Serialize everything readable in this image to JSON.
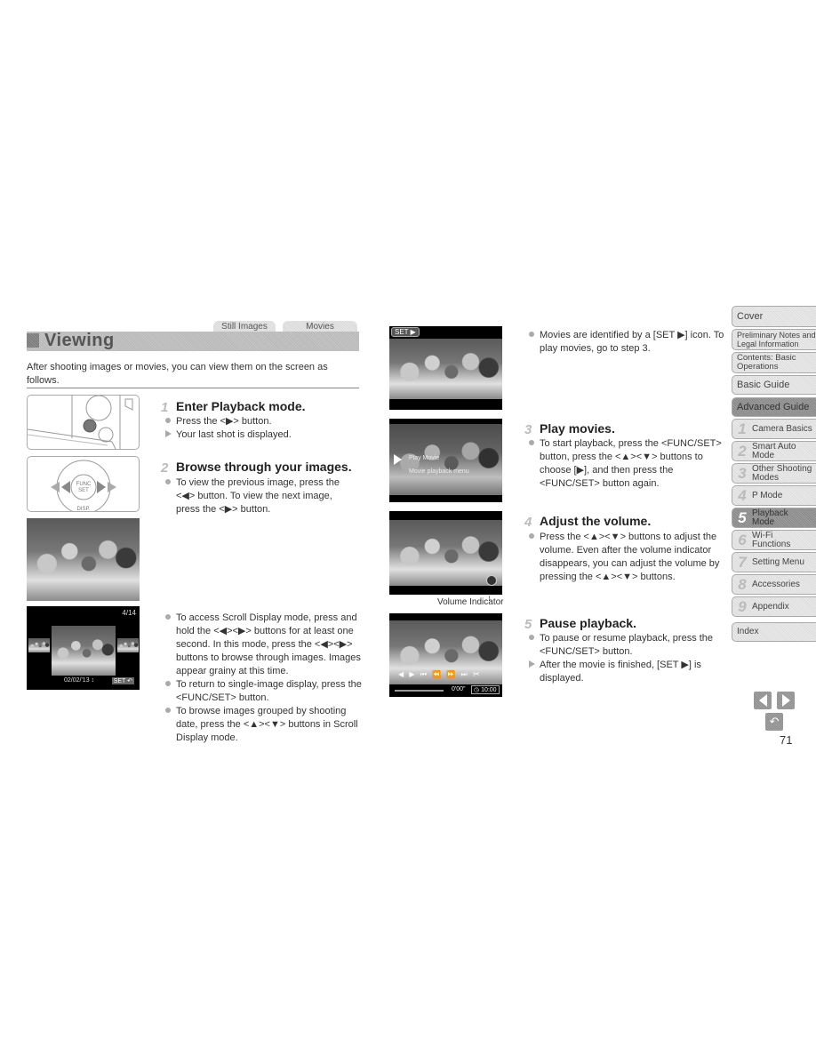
{
  "header": {
    "tabs": [
      "Still Images",
      "Movies"
    ],
    "title": "Viewing",
    "intro": "After shooting images or movies, you can view them on the screen as follows."
  },
  "steps": [
    {
      "number": "1",
      "title": "Enter Playback mode.",
      "items": [
        {
          "type": "bullet",
          "text": "Press the <▶> button."
        },
        {
          "type": "result",
          "text": "Your last shot is displayed."
        }
      ]
    },
    {
      "number": "2",
      "title": "Browse through your images.",
      "items": [
        {
          "type": "bullet",
          "text": "To view the previous image, press the <◀> button. To view the next image, press the <▶> button."
        }
      ],
      "extra_items": [
        {
          "type": "bullet",
          "text": "To access Scroll Display mode, press and hold the <◀><▶> buttons for at least one second. In this mode, press the <◀><▶> buttons to browse through images. Images appear grainy at this time."
        },
        {
          "type": "bullet",
          "text": "To return to single-image display, press the <FUNC/SET> button."
        },
        {
          "type": "bullet",
          "text": "To browse images grouped by shooting date, press the <▲><▼> buttons in Scroll Display mode."
        }
      ]
    },
    {
      "number": "3",
      "title": "Play movies.",
      "items": [
        {
          "type": "bullet",
          "text": "To start playback, press the <FUNC/SET> button, press the <▲><▼> buttons to choose [▶], and then press the <FUNC/SET> button again."
        }
      ]
    },
    {
      "number": "4",
      "title": "Adjust the volume.",
      "items": [
        {
          "type": "bullet",
          "text": "Press the <▲><▼> buttons to adjust the volume. Even after the volume indicator disappears, you can adjust the volume by pressing the <▲><▼> buttons."
        }
      ]
    },
    {
      "number": "5",
      "title": "Pause playback.",
      "items": [
        {
          "type": "bullet",
          "text": "To pause or resume playback, press the <FUNC/SET> button."
        },
        {
          "type": "result",
          "text": "After the movie is finished, [SET ▶] is displayed."
        }
      ]
    }
  ],
  "movie_note": "Movies are identified by a [SET ▶] icon. To play movies, go to step 3.",
  "screens": {
    "scroll_counter": "4/14",
    "scroll_date": "02/02/'13",
    "movie_badge": "SET ▶",
    "menu_items": [
      "Play Movie",
      "Movie playback menu"
    ],
    "volume_caption": "Volume Indicator",
    "time_elapsed": "0'00\"",
    "time_total": "10:00"
  },
  "nav": {
    "top_items": [
      {
        "label": "Cover"
      },
      {
        "label": "Preliminary Notes and Legal Information"
      },
      {
        "label": "Contents: Basic Operations"
      },
      {
        "label": "Basic Guide"
      },
      {
        "label": "Advanced Guide"
      }
    ],
    "chapters": [
      {
        "num": "1",
        "label": "Camera Basics"
      },
      {
        "num": "2",
        "label": "Smart Auto Mode"
      },
      {
        "num": "3",
        "label": "Other Shooting Modes"
      },
      {
        "num": "4",
        "label": "P Mode"
      },
      {
        "num": "5",
        "label": "Playback Mode",
        "active": true
      },
      {
        "num": "6",
        "label": "Wi-Fi Functions"
      },
      {
        "num": "7",
        "label": "Setting Menu"
      },
      {
        "num": "8",
        "label": "Accessories"
      },
      {
        "num": "9",
        "label": "Appendix"
      }
    ],
    "index_label": "Index"
  },
  "page_number": "71"
}
